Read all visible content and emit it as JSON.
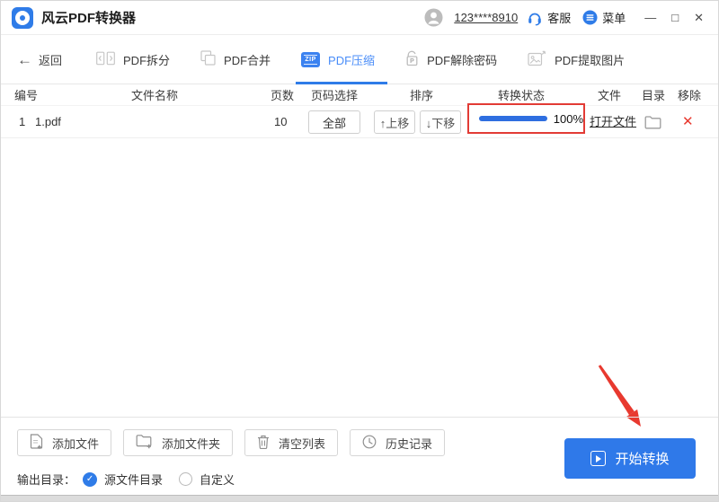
{
  "titlebar": {
    "app_title": "风云PDF转换器",
    "account": "123****8910",
    "service_label": "客服",
    "menu_label": "菜单",
    "minimize_glyph": "—",
    "maximize_glyph": "□",
    "close_glyph": "✕"
  },
  "toolbar": {
    "back_arrow": "←",
    "back_label": "返回",
    "zip_icon_text": "ZIP",
    "lock_icon_text": "P",
    "tabs": [
      {
        "label": "PDF拆分",
        "active": false
      },
      {
        "label": "PDF合并",
        "active": false
      },
      {
        "label": "PDF压缩",
        "active": true
      },
      {
        "label": "PDF解除密码",
        "active": false
      },
      {
        "label": "PDF提取图片",
        "active": false
      }
    ]
  },
  "table": {
    "headers": [
      "编号",
      "文件名称",
      "页数",
      "页码选择",
      "排序",
      "转换状态",
      "文件",
      "目录",
      "移除"
    ],
    "row": {
      "index": "1",
      "filename": "1.pdf",
      "pages": "10",
      "page_select": "全部",
      "move_up": "↑上移",
      "move_down": "↓下移",
      "progress_percent": "100%",
      "open_file": "打开文件",
      "remove_glyph": "✕"
    }
  },
  "footer": {
    "add_file": "添加文件",
    "add_folder": "添加文件夹",
    "clear_list": "清空列表",
    "history": "历史记录",
    "output_dir_label": "输出目录：",
    "source_dir_option": "源文件目录",
    "custom_option": "自定义",
    "start_button": "开始转换"
  },
  "colors": {
    "accent_blue": "#2F7CE8",
    "active_tab_text": "#4A8DF8",
    "progress_blue": "#2E6EE0",
    "annotation_red": "#E8392F",
    "remove_red": "#E8392F"
  }
}
